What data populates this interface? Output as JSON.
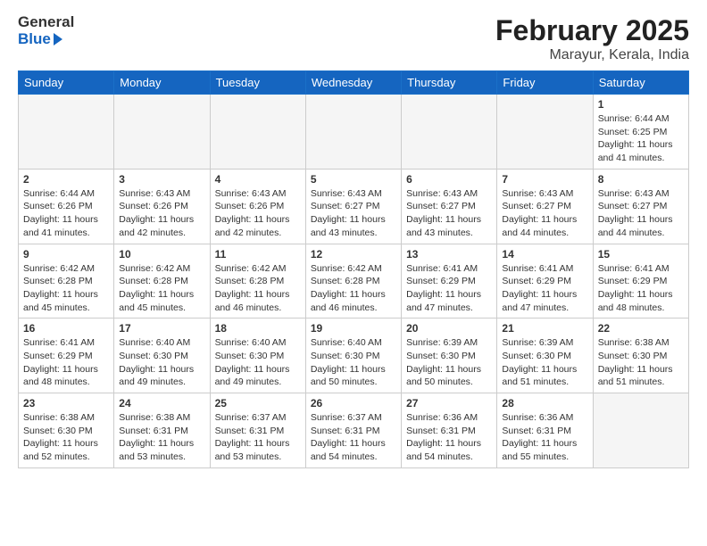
{
  "header": {
    "logo": {
      "text_general": "General",
      "text_blue": "Blue"
    },
    "title": "February 2025",
    "location": "Marayur, Kerala, India"
  },
  "days_of_week": [
    "Sunday",
    "Monday",
    "Tuesday",
    "Wednesday",
    "Thursday",
    "Friday",
    "Saturday"
  ],
  "weeks": [
    [
      {
        "day": "",
        "empty": true
      },
      {
        "day": "",
        "empty": true
      },
      {
        "day": "",
        "empty": true
      },
      {
        "day": "",
        "empty": true
      },
      {
        "day": "",
        "empty": true
      },
      {
        "day": "",
        "empty": true
      },
      {
        "day": "1",
        "sunrise": "6:44 AM",
        "sunset": "6:25 PM",
        "daylight": "11 hours and 41 minutes."
      }
    ],
    [
      {
        "day": "2",
        "sunrise": "6:44 AM",
        "sunset": "6:26 PM",
        "daylight": "11 hours and 41 minutes."
      },
      {
        "day": "3",
        "sunrise": "6:43 AM",
        "sunset": "6:26 PM",
        "daylight": "11 hours and 42 minutes."
      },
      {
        "day": "4",
        "sunrise": "6:43 AM",
        "sunset": "6:26 PM",
        "daylight": "11 hours and 42 minutes."
      },
      {
        "day": "5",
        "sunrise": "6:43 AM",
        "sunset": "6:27 PM",
        "daylight": "11 hours and 43 minutes."
      },
      {
        "day": "6",
        "sunrise": "6:43 AM",
        "sunset": "6:27 PM",
        "daylight": "11 hours and 43 minutes."
      },
      {
        "day": "7",
        "sunrise": "6:43 AM",
        "sunset": "6:27 PM",
        "daylight": "11 hours and 44 minutes."
      },
      {
        "day": "8",
        "sunrise": "6:43 AM",
        "sunset": "6:27 PM",
        "daylight": "11 hours and 44 minutes."
      }
    ],
    [
      {
        "day": "9",
        "sunrise": "6:42 AM",
        "sunset": "6:28 PM",
        "daylight": "11 hours and 45 minutes."
      },
      {
        "day": "10",
        "sunrise": "6:42 AM",
        "sunset": "6:28 PM",
        "daylight": "11 hours and 45 minutes."
      },
      {
        "day": "11",
        "sunrise": "6:42 AM",
        "sunset": "6:28 PM",
        "daylight": "11 hours and 46 minutes."
      },
      {
        "day": "12",
        "sunrise": "6:42 AM",
        "sunset": "6:28 PM",
        "daylight": "11 hours and 46 minutes."
      },
      {
        "day": "13",
        "sunrise": "6:41 AM",
        "sunset": "6:29 PM",
        "daylight": "11 hours and 47 minutes."
      },
      {
        "day": "14",
        "sunrise": "6:41 AM",
        "sunset": "6:29 PM",
        "daylight": "11 hours and 47 minutes."
      },
      {
        "day": "15",
        "sunrise": "6:41 AM",
        "sunset": "6:29 PM",
        "daylight": "11 hours and 48 minutes."
      }
    ],
    [
      {
        "day": "16",
        "sunrise": "6:41 AM",
        "sunset": "6:29 PM",
        "daylight": "11 hours and 48 minutes."
      },
      {
        "day": "17",
        "sunrise": "6:40 AM",
        "sunset": "6:30 PM",
        "daylight": "11 hours and 49 minutes."
      },
      {
        "day": "18",
        "sunrise": "6:40 AM",
        "sunset": "6:30 PM",
        "daylight": "11 hours and 49 minutes."
      },
      {
        "day": "19",
        "sunrise": "6:40 AM",
        "sunset": "6:30 PM",
        "daylight": "11 hours and 50 minutes."
      },
      {
        "day": "20",
        "sunrise": "6:39 AM",
        "sunset": "6:30 PM",
        "daylight": "11 hours and 50 minutes."
      },
      {
        "day": "21",
        "sunrise": "6:39 AM",
        "sunset": "6:30 PM",
        "daylight": "11 hours and 51 minutes."
      },
      {
        "day": "22",
        "sunrise": "6:38 AM",
        "sunset": "6:30 PM",
        "daylight": "11 hours and 51 minutes."
      }
    ],
    [
      {
        "day": "23",
        "sunrise": "6:38 AM",
        "sunset": "6:30 PM",
        "daylight": "11 hours and 52 minutes."
      },
      {
        "day": "24",
        "sunrise": "6:38 AM",
        "sunset": "6:31 PM",
        "daylight": "11 hours and 53 minutes."
      },
      {
        "day": "25",
        "sunrise": "6:37 AM",
        "sunset": "6:31 PM",
        "daylight": "11 hours and 53 minutes."
      },
      {
        "day": "26",
        "sunrise": "6:37 AM",
        "sunset": "6:31 PM",
        "daylight": "11 hours and 54 minutes."
      },
      {
        "day": "27",
        "sunrise": "6:36 AM",
        "sunset": "6:31 PM",
        "daylight": "11 hours and 54 minutes."
      },
      {
        "day": "28",
        "sunrise": "6:36 AM",
        "sunset": "6:31 PM",
        "daylight": "11 hours and 55 minutes."
      },
      {
        "day": "",
        "empty": true
      }
    ]
  ],
  "labels": {
    "sunrise": "Sunrise:",
    "sunset": "Sunset:",
    "daylight": "Daylight:"
  }
}
